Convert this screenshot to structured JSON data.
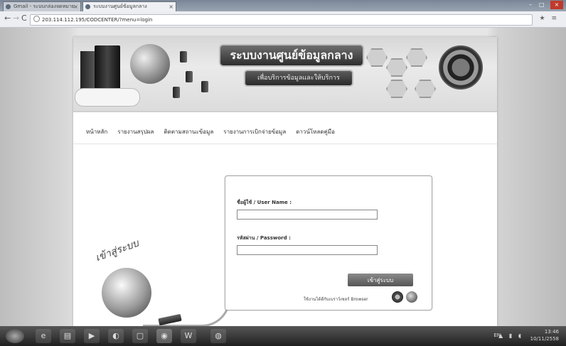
{
  "browser": {
    "tabs": [
      {
        "label": "Gmail - ระบบกล่องจดหมาย"
      },
      {
        "label": "ระบบงานศูนย์ข้อมูลกลาง"
      }
    ],
    "tab_close": "×",
    "address": "203.114.112.195/CODCENTER/?menu=login",
    "toolbar_icons": "★ ≡"
  },
  "banner": {
    "title": "ระบบงานศูนย์ข้อมูลกลาง",
    "subtitle": "เพื่อบริการข้อมูลและให้บริการ"
  },
  "menu": {
    "items": [
      "หน้าหลัก",
      "รายงานสรุปผล",
      "ติดตามสถานะข้อมูล",
      "รายงานการเบิกจ่ายข้อมูล",
      "ดาวน์โหลดคู่มือ"
    ]
  },
  "illustration": {
    "caption": "เข้าสู่ระบบ"
  },
  "login": {
    "username_label": "ชื่อผู้ใช้ / User Name :",
    "username_value": "",
    "password_label": "รหัสผ่าน / Password :",
    "password_value": "",
    "submit_label": "เข้าสู่ระบบ",
    "browser_note": "ใช้งานได้ดีกับเบราว์เซอร์ Browser"
  },
  "taskbar": {
    "time": "13:46",
    "date": "10/11/2558",
    "lang": "EN"
  }
}
